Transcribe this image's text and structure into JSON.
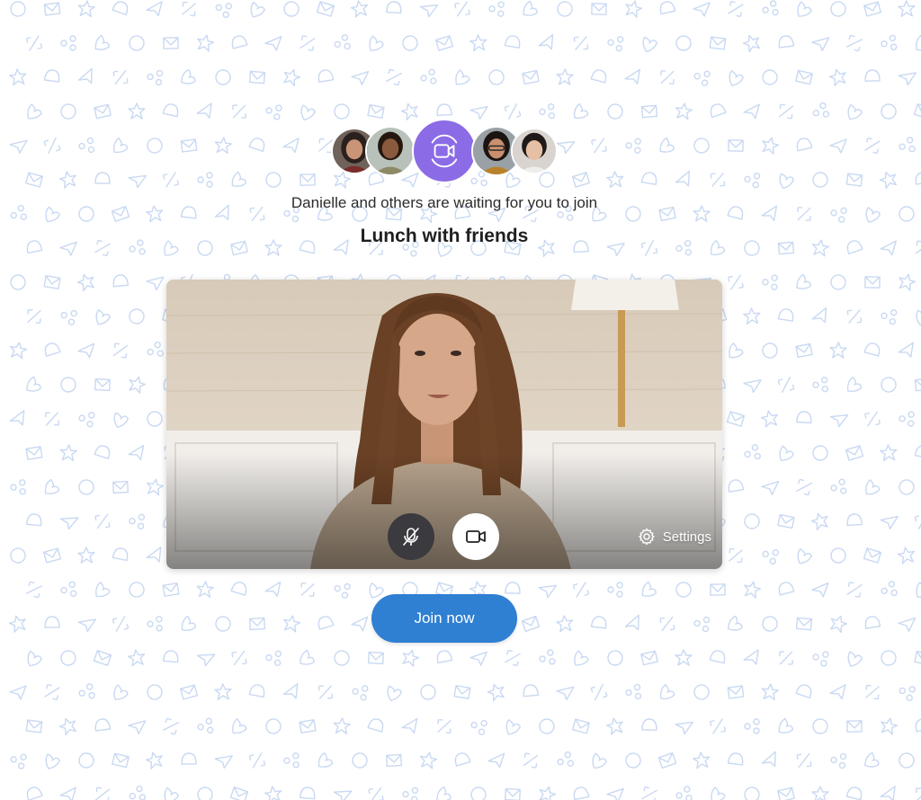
{
  "participants": {
    "avatars": [
      {
        "name": "avatar-1"
      },
      {
        "name": "avatar-2"
      },
      {
        "name": "avatar-3"
      },
      {
        "name": "avatar-4"
      }
    ],
    "call_icon": "video-call-icon"
  },
  "lobby": {
    "waiting_text": "Danielle and others are waiting for you to join",
    "meeting_title": "Lunch with friends"
  },
  "preview": {
    "mic_icon": "mic-off-icon",
    "camera_icon": "camera-icon",
    "settings_icon": "gear-icon",
    "settings_label": "Settings"
  },
  "actions": {
    "join_label": "Join now"
  },
  "colors": {
    "accent_purple": "#8b6be6",
    "join_blue": "#2f7fd3",
    "pattern_blue": "#c9d9f2",
    "mic_button": "#3a3a3f"
  }
}
